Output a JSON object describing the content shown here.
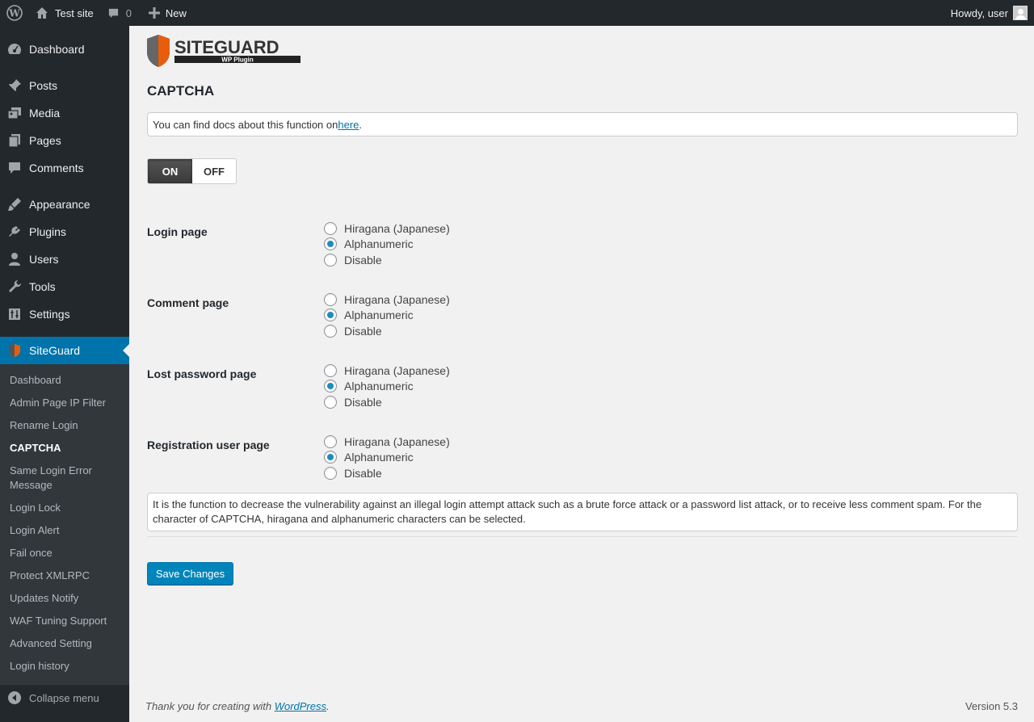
{
  "adminbar": {
    "site_name": "Test site",
    "comment_count": "0",
    "new_label": "New",
    "howdy": "Howdy, user"
  },
  "sidebar": {
    "items": [
      {
        "label": "Dashboard",
        "icon": "dashboard-icon"
      },
      {
        "label": "Posts",
        "icon": "pin-icon"
      },
      {
        "label": "Media",
        "icon": "media-icon"
      },
      {
        "label": "Pages",
        "icon": "pages-icon"
      },
      {
        "label": "Comments",
        "icon": "comment-icon"
      },
      {
        "label": "Appearance",
        "icon": "brush-icon"
      },
      {
        "label": "Plugins",
        "icon": "plug-icon"
      },
      {
        "label": "Users",
        "icon": "user-icon"
      },
      {
        "label": "Tools",
        "icon": "wrench-icon"
      },
      {
        "label": "Settings",
        "icon": "settings-icon"
      },
      {
        "label": "SiteGuard",
        "icon": "siteguard-icon"
      }
    ],
    "submenu": [
      "Dashboard",
      "Admin Page IP Filter",
      "Rename Login",
      "CAPTCHA",
      "Same Login Error Message",
      "Login Lock",
      "Login Alert",
      "Fail once",
      "Protect XMLRPC",
      "Updates Notify",
      "WAF Tuning Support",
      "Advanced Setting",
      "Login history"
    ],
    "collapse_label": "Collapse menu"
  },
  "logo": {
    "brand": "SITEGUARD",
    "sub": "WP Plugin"
  },
  "page": {
    "title": "CAPTCHA",
    "docs_text": "You can find docs about this function on ",
    "docs_link": "here",
    "docs_end": ".",
    "toggle_on": "ON",
    "toggle_off": "OFF"
  },
  "groups": [
    {
      "label": "Login page",
      "options": [
        "Hiragana (Japanese)",
        "Alphanumeric",
        "Disable"
      ],
      "selected": 1
    },
    {
      "label": "Comment page",
      "options": [
        "Hiragana (Japanese)",
        "Alphanumeric",
        "Disable"
      ],
      "selected": 1
    },
    {
      "label": "Lost password page",
      "options": [
        "Hiragana (Japanese)",
        "Alphanumeric",
        "Disable"
      ],
      "selected": 1
    },
    {
      "label": "Registration user page",
      "options": [
        "Hiragana (Japanese)",
        "Alphanumeric",
        "Disable"
      ],
      "selected": 1
    }
  ],
  "description": "It is the function to decrease the vulnerability against an illegal login attempt attack such as a brute force attack or a password list attack, or to receive less comment spam. For the character of CAPTCHA, hiragana and alphanumeric characters can be selected.",
  "save_label": "Save Changes",
  "footer": {
    "thanks_pre": "Thank you for creating with ",
    "thanks_link": "WordPress",
    "thanks_end": ".",
    "version": "Version 5.3"
  },
  "colors": {
    "accent": "#0073aa",
    "sidebar": "#23282d",
    "submenu": "#32373c",
    "radio_checked": "#1e8cbe"
  }
}
